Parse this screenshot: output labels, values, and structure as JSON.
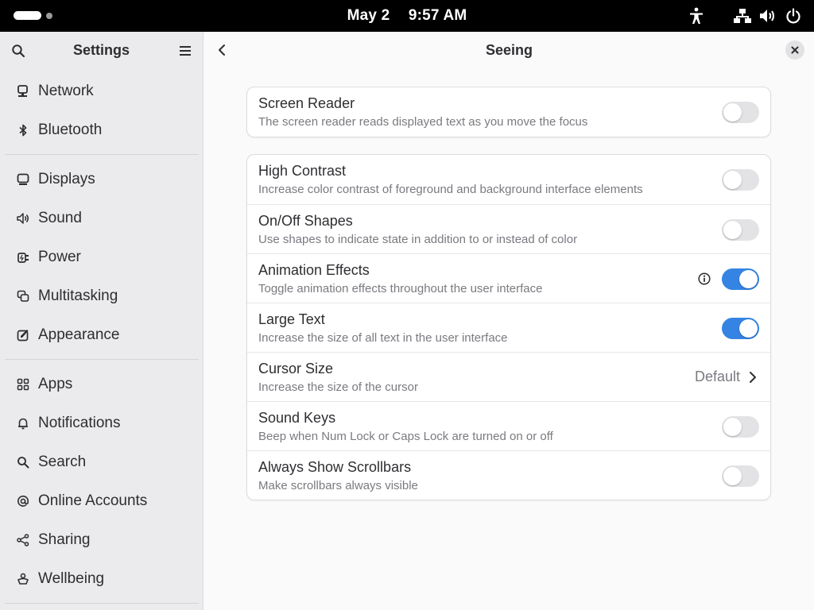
{
  "topbar": {
    "date": "May 2",
    "time": "9:57 AM",
    "icons": [
      "accessibility-icon",
      "network-icon",
      "volume-icon",
      "power-icon"
    ]
  },
  "sidebar": {
    "title": "Settings",
    "items": [
      {
        "label": "Network",
        "icon": "network-icon"
      },
      {
        "label": "Bluetooth",
        "icon": "bluetooth-icon"
      },
      {
        "label": "Displays",
        "icon": "display-icon"
      },
      {
        "label": "Sound",
        "icon": "sound-icon"
      },
      {
        "label": "Power",
        "icon": "power-plug-icon"
      },
      {
        "label": "Multitasking",
        "icon": "multitasking-icon"
      },
      {
        "label": "Appearance",
        "icon": "appearance-icon"
      },
      {
        "label": "Apps",
        "icon": "apps-grid-icon"
      },
      {
        "label": "Notifications",
        "icon": "bell-icon"
      },
      {
        "label": "Search",
        "icon": "search-icon"
      },
      {
        "label": "Online Accounts",
        "icon": "at-icon"
      },
      {
        "label": "Sharing",
        "icon": "share-icon"
      },
      {
        "label": "Wellbeing",
        "icon": "wellbeing-icon"
      }
    ]
  },
  "page": {
    "title": "Seeing"
  },
  "card1": [
    {
      "title": "Screen Reader",
      "subtitle": "The screen reader reads displayed text as you move the focus",
      "state": "off"
    }
  ],
  "card2": [
    {
      "title": "High Contrast",
      "subtitle": "Increase color contrast of foreground and background interface elements",
      "state": "off"
    },
    {
      "title": "On/Off Shapes",
      "subtitle": "Use shapes to indicate state in addition to or instead of color",
      "state": "off"
    },
    {
      "title": "Animation Effects",
      "subtitle": "Toggle animation effects throughout the user interface",
      "state": "on"
    },
    {
      "title": "Large Text",
      "subtitle": "Increase the size of all text in the user interface",
      "state": "on"
    },
    {
      "title": "Cursor Size",
      "subtitle": "Increase the size of the cursor",
      "value": "Default"
    },
    {
      "title": "Sound Keys",
      "subtitle": "Beep when Num Lock or Caps Lock are turned on or off",
      "state": "off"
    },
    {
      "title": "Always Show Scrollbars",
      "subtitle": "Make scrollbars always visible",
      "state": "off"
    }
  ],
  "colors": {
    "accent": "#3584e4",
    "sidebar_bg": "#ebebed",
    "content_bg": "#fafafb",
    "topbar_bg": "#000000"
  }
}
